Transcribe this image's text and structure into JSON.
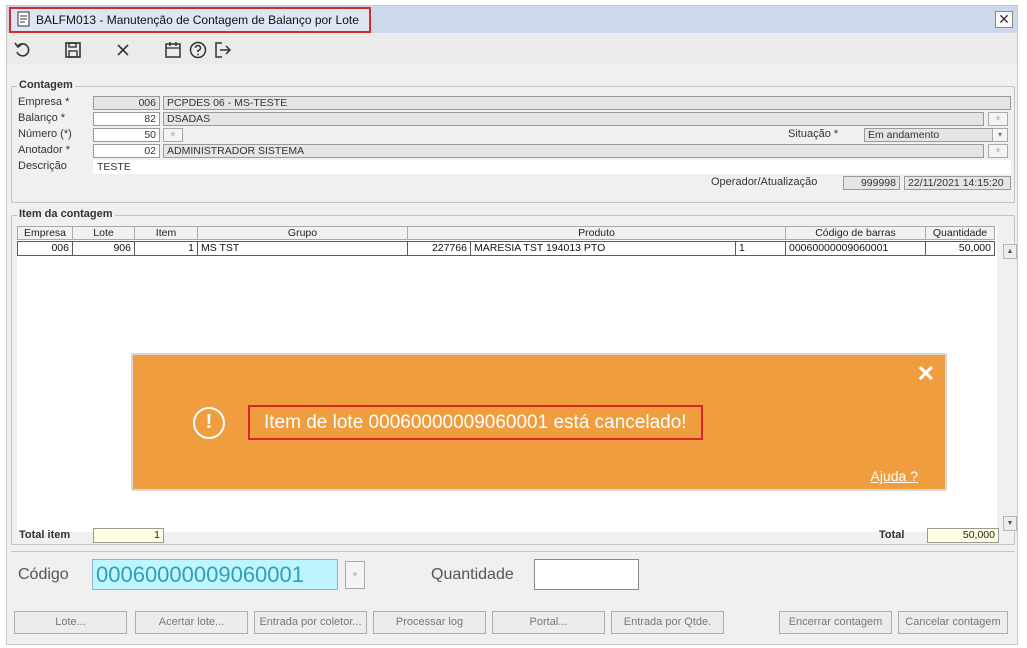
{
  "window": {
    "title": "BALFM013 - Manutenção de Contagem de Balanço por Lote",
    "close_label": "✕"
  },
  "toolbar": {
    "icons": [
      "undo-icon",
      "save-icon",
      "cancel-icon",
      "calendar-icon",
      "help-icon",
      "exit-icon"
    ]
  },
  "contagem": {
    "legend": "Contagem",
    "empresa_label": "Empresa *",
    "empresa_code": "006",
    "empresa_name": "PCPDES 06 - MS-TESTE",
    "balanco_label": "Balanço *",
    "balanco_code": "82",
    "balanco_name": "DSADAS",
    "numero_label": "Número (*)",
    "numero_value": "50",
    "situacao_label": "Situação *",
    "situacao_value": "Em andamento",
    "anotador_label": "Anotador *",
    "anotador_code": "02",
    "anotador_name": "ADMINISTRADOR SISTEMA",
    "descricao_label": "Descrição",
    "descricao_value": "TESTE",
    "operador_label": "Operador/Atualização",
    "operador_value": "999998",
    "atualizacao_value": "22/11/2021 14:15:20"
  },
  "itens": {
    "legend": "Item da contagem",
    "columns": [
      "Empresa",
      "Lote",
      "Item",
      "Grupo",
      "Produto",
      "Código de barras",
      "Quantidade"
    ],
    "rows": [
      {
        "empresa": "006",
        "lote": "906",
        "item": "1",
        "grupo": "MS TST",
        "produto_code": "227766",
        "produto_name": "MARESIA TST 194013 PTO",
        "produto_extra": "1",
        "codigo_barras": "00060000009060001",
        "quantidade": "50,000"
      }
    ]
  },
  "toast": {
    "message": "Item de lote 00060000009060001 está cancelado!",
    "help": "Ajuda ?",
    "close": "✕",
    "icon": "!",
    "color": "#ef9d3e"
  },
  "totals": {
    "total_item_label": "Total item",
    "total_item_value": "1",
    "total_label": "Total",
    "total_value": "50,000"
  },
  "entry": {
    "codigo_label": "Código",
    "codigo_value": "00060000009060001",
    "quantidade_label": "Quantidade",
    "quantidade_value": ""
  },
  "buttons": {
    "lote": "Lote...",
    "acertar_lote": "Acertar lote...",
    "entrada_coletor": "Entrada por coletor...",
    "processar_log": "Processar log",
    "portal": "Portal...",
    "entrada_qtde": "Entrada por Qtde.",
    "encerrar": "Encerrar contagem",
    "cancelar": "Cancelar contagem"
  }
}
